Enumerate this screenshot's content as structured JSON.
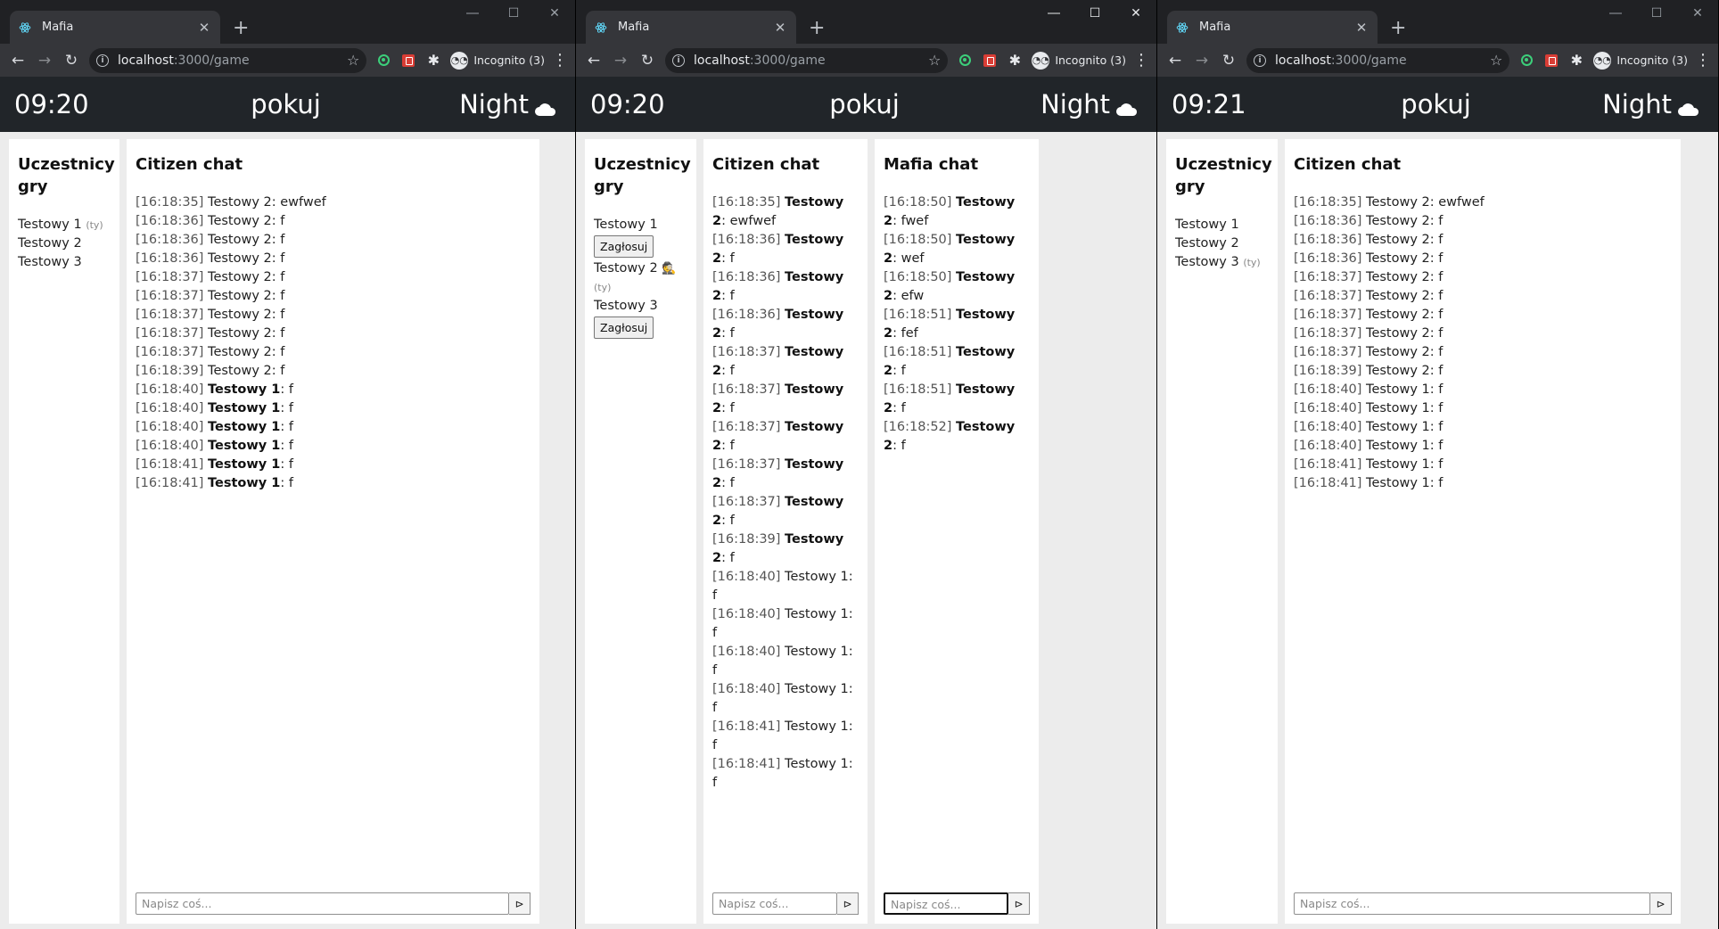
{
  "browser": {
    "tab_title": "Mafia",
    "url_host": "localhost",
    "url_path": ":3000/game",
    "incognito_label": "Incognito (3)"
  },
  "icons": {
    "favicon": "react-atom-icon",
    "phase_icon": "cloud-moon-icon",
    "send": "send-icon",
    "mafia_marker": "spy-icon"
  },
  "windows": [
    {
      "header": {
        "time": "09:20",
        "room": "pokuj",
        "phase": "Night"
      },
      "participants": {
        "title": "Uczestnicy gry",
        "players": [
          {
            "name": "Testowy 1",
            "you": "(ty)"
          },
          {
            "name": "Testowy 2"
          },
          {
            "name": "Testowy 3"
          }
        ]
      },
      "citizen_chat": {
        "title": "Citizen chat",
        "placeholder": "Napisz coś...",
        "messages": [
          {
            "ts": "[16:18:35]",
            "author": "Testowy 2",
            "text": ": ewfwef",
            "bold": false
          },
          {
            "ts": "[16:18:36]",
            "author": "Testowy 2",
            "text": ": f",
            "bold": false
          },
          {
            "ts": "[16:18:36]",
            "author": "Testowy 2",
            "text": ": f",
            "bold": false
          },
          {
            "ts": "[16:18:36]",
            "author": "Testowy 2",
            "text": ": f",
            "bold": false
          },
          {
            "ts": "[16:18:37]",
            "author": "Testowy 2",
            "text": ": f",
            "bold": false
          },
          {
            "ts": "[16:18:37]",
            "author": "Testowy 2",
            "text": ": f",
            "bold": false
          },
          {
            "ts": "[16:18:37]",
            "author": "Testowy 2",
            "text": ": f",
            "bold": false
          },
          {
            "ts": "[16:18:37]",
            "author": "Testowy 2",
            "text": ": f",
            "bold": false
          },
          {
            "ts": "[16:18:37]",
            "author": "Testowy 2",
            "text": ": f",
            "bold": false
          },
          {
            "ts": "[16:18:39]",
            "author": "Testowy 2",
            "text": ": f",
            "bold": false
          },
          {
            "ts": "[16:18:40]",
            "author": "Testowy 1",
            "text": ": f",
            "bold": true
          },
          {
            "ts": "[16:18:40]",
            "author": "Testowy 1",
            "text": ": f",
            "bold": true
          },
          {
            "ts": "[16:18:40]",
            "author": "Testowy 1",
            "text": ": f",
            "bold": true
          },
          {
            "ts": "[16:18:40]",
            "author": "Testowy 1",
            "text": ": f",
            "bold": true
          },
          {
            "ts": "[16:18:41]",
            "author": "Testowy 1",
            "text": ": f",
            "bold": true
          },
          {
            "ts": "[16:18:41]",
            "author": "Testowy 1",
            "text": ": f",
            "bold": true
          }
        ]
      }
    },
    {
      "header": {
        "time": "09:20",
        "room": "pokuj",
        "phase": "Night"
      },
      "participants": {
        "title": "Uczestnicy gry",
        "vote_label": "Zagłosuj",
        "players": [
          {
            "name": "Testowy 1",
            "vote": true
          },
          {
            "name": "Testowy 2",
            "mafia": true,
            "you": "(ty)"
          },
          {
            "name": "Testowy 3",
            "vote": true
          }
        ]
      },
      "citizen_chat": {
        "title": "Citizen chat",
        "placeholder": "Napisz coś...",
        "messages": [
          {
            "ts": "[16:18:35]",
            "author": "Testowy 2",
            "text": ": ewfwef",
            "bold": true
          },
          {
            "ts": "[16:18:36]",
            "author": "Testowy 2",
            "text": ": f",
            "bold": true
          },
          {
            "ts": "[16:18:36]",
            "author": "Testowy 2",
            "text": ": f",
            "bold": true
          },
          {
            "ts": "[16:18:36]",
            "author": "Testowy 2",
            "text": ": f",
            "bold": true
          },
          {
            "ts": "[16:18:37]",
            "author": "Testowy 2",
            "text": ": f",
            "bold": true
          },
          {
            "ts": "[16:18:37]",
            "author": "Testowy 2",
            "text": ": f",
            "bold": true
          },
          {
            "ts": "[16:18:37]",
            "author": "Testowy 2",
            "text": ": f",
            "bold": true
          },
          {
            "ts": "[16:18:37]",
            "author": "Testowy 2",
            "text": ": f",
            "bold": true
          },
          {
            "ts": "[16:18:37]",
            "author": "Testowy 2",
            "text": ": f",
            "bold": true
          },
          {
            "ts": "[16:18:39]",
            "author": "Testowy 2",
            "text": ": f",
            "bold": true
          },
          {
            "ts": "[16:18:40]",
            "author": "Testowy 1",
            "text": ": f",
            "bold": false
          },
          {
            "ts": "[16:18:40]",
            "author": "Testowy 1",
            "text": ": f",
            "bold": false
          },
          {
            "ts": "[16:18:40]",
            "author": "Testowy 1",
            "text": ": f",
            "bold": false
          },
          {
            "ts": "[16:18:40]",
            "author": "Testowy 1",
            "text": ": f",
            "bold": false
          },
          {
            "ts": "[16:18:41]",
            "author": "Testowy 1",
            "text": ": f",
            "bold": false
          },
          {
            "ts": "[16:18:41]",
            "author": "Testowy 1",
            "text": ": f",
            "bold": false
          }
        ]
      },
      "mafia_chat": {
        "title": "Mafia chat",
        "placeholder": "Napisz coś...",
        "messages": [
          {
            "ts": "[16:18:50]",
            "author": "Testowy 2",
            "text": ": fwef",
            "bold": true
          },
          {
            "ts": "[16:18:50]",
            "author": "Testowy 2",
            "text": ": wef",
            "bold": true
          },
          {
            "ts": "[16:18:50]",
            "author": "Testowy 2",
            "text": ": efw",
            "bold": true
          },
          {
            "ts": "[16:18:51]",
            "author": "Testowy 2",
            "text": ": fef",
            "bold": true
          },
          {
            "ts": "[16:18:51]",
            "author": "Testowy 2",
            "text": ": f",
            "bold": true
          },
          {
            "ts": "[16:18:51]",
            "author": "Testowy 2",
            "text": ": f",
            "bold": true
          },
          {
            "ts": "[16:18:52]",
            "author": "Testowy 2",
            "text": ": f",
            "bold": true
          }
        ]
      }
    },
    {
      "header": {
        "time": "09:21",
        "room": "pokuj",
        "phase": "Night"
      },
      "participants": {
        "title": "Uczestnicy gry",
        "players": [
          {
            "name": "Testowy 1"
          },
          {
            "name": "Testowy 2"
          },
          {
            "name": "Testowy 3",
            "you": "(ty)"
          }
        ]
      },
      "citizen_chat": {
        "title": "Citizen chat",
        "placeholder": "Napisz coś...",
        "messages": [
          {
            "ts": "[16:18:35]",
            "author": "Testowy 2",
            "text": ": ewfwef",
            "bold": false
          },
          {
            "ts": "[16:18:36]",
            "author": "Testowy 2",
            "text": ": f",
            "bold": false
          },
          {
            "ts": "[16:18:36]",
            "author": "Testowy 2",
            "text": ": f",
            "bold": false
          },
          {
            "ts": "[16:18:36]",
            "author": "Testowy 2",
            "text": ": f",
            "bold": false
          },
          {
            "ts": "[16:18:37]",
            "author": "Testowy 2",
            "text": ": f",
            "bold": false
          },
          {
            "ts": "[16:18:37]",
            "author": "Testowy 2",
            "text": ": f",
            "bold": false
          },
          {
            "ts": "[16:18:37]",
            "author": "Testowy 2",
            "text": ": f",
            "bold": false
          },
          {
            "ts": "[16:18:37]",
            "author": "Testowy 2",
            "text": ": f",
            "bold": false
          },
          {
            "ts": "[16:18:37]",
            "author": "Testowy 2",
            "text": ": f",
            "bold": false
          },
          {
            "ts": "[16:18:39]",
            "author": "Testowy 2",
            "text": ": f",
            "bold": false
          },
          {
            "ts": "[16:18:40]",
            "author": "Testowy 1",
            "text": ": f",
            "bold": false
          },
          {
            "ts": "[16:18:40]",
            "author": "Testowy 1",
            "text": ": f",
            "bold": false
          },
          {
            "ts": "[16:18:40]",
            "author": "Testowy 1",
            "text": ": f",
            "bold": false
          },
          {
            "ts": "[16:18:40]",
            "author": "Testowy 1",
            "text": ": f",
            "bold": false
          },
          {
            "ts": "[16:18:41]",
            "author": "Testowy 1",
            "text": ": f",
            "bold": false
          },
          {
            "ts": "[16:18:41]",
            "author": "Testowy 1",
            "text": ": f",
            "bold": false
          }
        ]
      }
    }
  ]
}
